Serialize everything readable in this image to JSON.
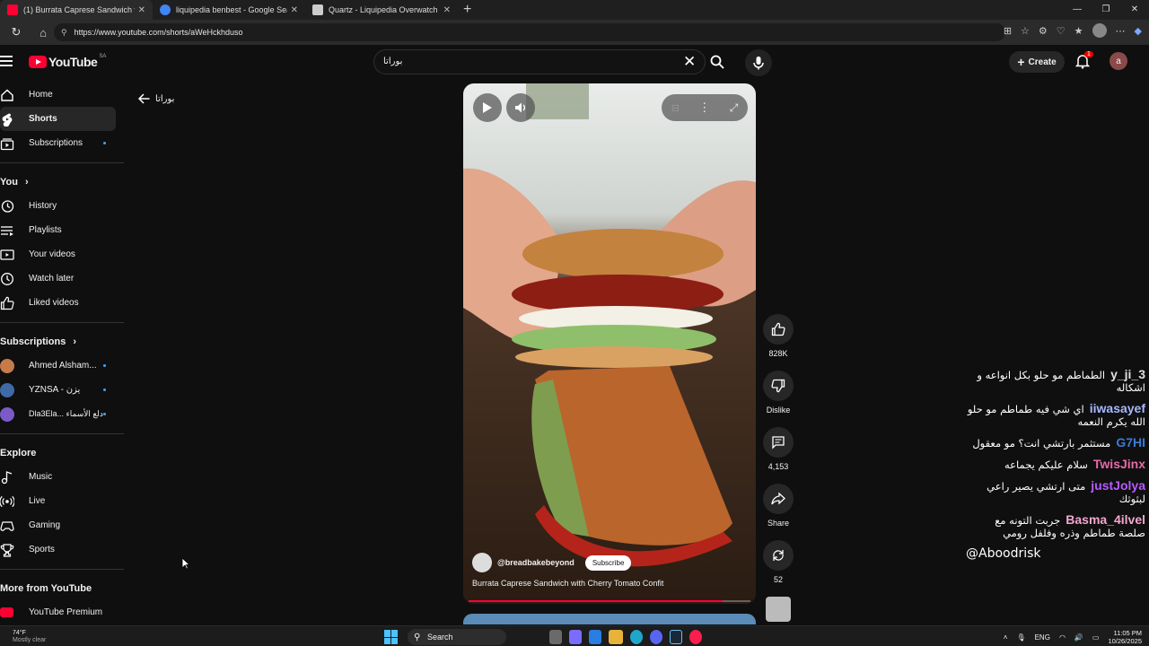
{
  "browser": {
    "tabs": [
      {
        "title": "(1) Burrata Caprese Sandwich wit",
        "favicon_color": "#ff0033",
        "active": true
      },
      {
        "title": "liquipedia benbest - Google Sear",
        "favicon_color": "#4285f4",
        "active": false
      },
      {
        "title": "Quartz - Liquipedia Overwatch W",
        "favicon_color": "#cccccc",
        "active": false
      }
    ],
    "url": "https://www.youtube.com/shorts/aWeHckhduso"
  },
  "header": {
    "logo_text": "YouTube",
    "region": "SA",
    "search_value": "بوراتا",
    "create_label": "Create",
    "notification_count": "1",
    "account_initial": "a"
  },
  "sidebar": {
    "main": [
      {
        "label": "Home",
        "icon": "home-icon"
      },
      {
        "label": "Shorts",
        "icon": "shorts-icon",
        "selected": true
      },
      {
        "label": "Subscriptions",
        "icon": "subscriptions-icon",
        "dot": true
      }
    ],
    "you_heading": "You",
    "you": [
      {
        "label": "History",
        "icon": "history-icon"
      },
      {
        "label": "Playlists",
        "icon": "playlists-icon"
      },
      {
        "label": "Your videos",
        "icon": "your-videos-icon"
      },
      {
        "label": "Watch later",
        "icon": "watch-later-icon"
      },
      {
        "label": "Liked videos",
        "icon": "liked-videos-icon"
      }
    ],
    "subscriptions_heading": "Subscriptions",
    "subscriptions": [
      {
        "label": "Ahmed Alsham...",
        "color": "#c77b4a"
      },
      {
        "label": "YZNSA - يزن",
        "color": "#3f6aa8"
      },
      {
        "label": "Dla3Ela... دلع الأسماء",
        "color": "#7a5ac8"
      }
    ],
    "explore_heading": "Explore",
    "explore": [
      {
        "label": "Music",
        "icon": "music-icon"
      },
      {
        "label": "Live",
        "icon": "live-icon"
      },
      {
        "label": "Gaming",
        "icon": "gaming-icon"
      },
      {
        "label": "Sports",
        "icon": "sports-icon"
      }
    ],
    "more_heading": "More from YouTube",
    "more": [
      {
        "label": "YouTube Premium",
        "icon": "youtube-premium-icon"
      }
    ]
  },
  "back_label": "بوراتا",
  "short": {
    "channel": "@breadbakebeyond",
    "subscribe_label": "Subscribe",
    "title": "Burrata Caprese Sandwich with Cherry Tomato Confit",
    "progress_fraction": 0.9
  },
  "actions": {
    "likes": "828K",
    "dislike_label": "Dislike",
    "comments": "4,153",
    "share_label": "Share",
    "remix_count": "52"
  },
  "chat": [
    {
      "user": "y_ji_3",
      "color": "#e0e0e0",
      "text": "الطماطم مو حلو بكل انواعه و اشكاله"
    },
    {
      "user": "iiwasayef",
      "color": "#a8b8ff",
      "text": "اي شي فيه طماطم مو حلو الله يكرم النعمه"
    },
    {
      "user": "G7HI",
      "color": "#3a7bd5",
      "text": "مستثمر بارتشي انت؟ مو معقول"
    },
    {
      "user": "TwisJinx",
      "color": "#e86aa8",
      "text": "سلام عليكم يجماعه"
    },
    {
      "user": "justJolya",
      "color": "#b65bff",
      "text": "متى ارتشي يصير راعي لبثوثك"
    },
    {
      "user": "Basma_4ilvel",
      "color": "#f2a7d0",
      "text": "جربت التونه مع صلصة طماطم وذره وفلفل رومي"
    },
    {
      "last": "@Aboodrisk"
    }
  ],
  "taskbar": {
    "temp": "74°F",
    "weather": "Mostly clear",
    "search_label": "Search",
    "lang": "ENG",
    "time": "11:05 PM",
    "date": "10/26/2025"
  }
}
